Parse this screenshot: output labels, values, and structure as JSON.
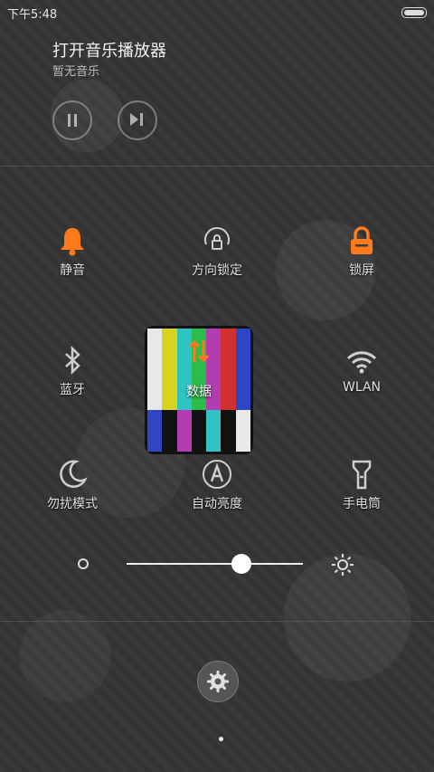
{
  "status_bar": {
    "time": "下午5:48"
  },
  "music": {
    "title": "打开音乐播放器",
    "subtitle": "暂无音乐"
  },
  "toggles": {
    "silent": "静音",
    "rotation_lock": "方向锁定",
    "lock_screen": "锁屏",
    "bluetooth": "蓝牙",
    "data": "数据",
    "wlan": "WLAN",
    "do_not_disturb": "勿扰模式",
    "auto_brightness": "自动亮度",
    "flashlight": "手电筒"
  },
  "brightness": {
    "level": 0.65
  },
  "colors": {
    "accent_active": "#ff7a1a",
    "inactive": "#cfcfcf"
  }
}
